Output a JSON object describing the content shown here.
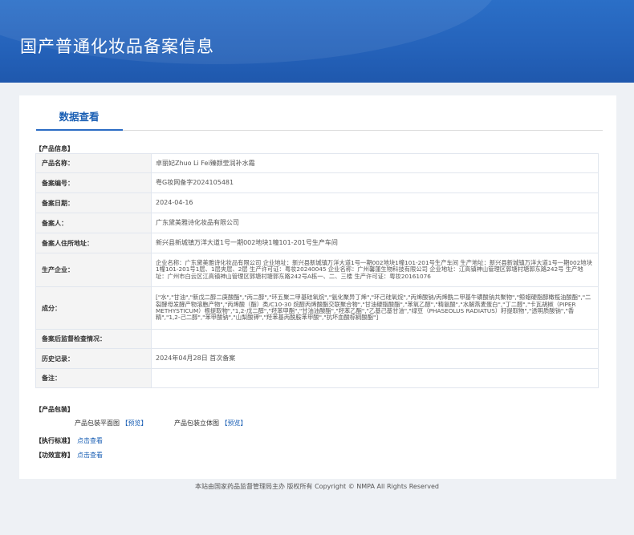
{
  "header": {
    "title": "国产普通化妆品备案信息"
  },
  "tab": {
    "label": "数据查看"
  },
  "product_info": {
    "section_title": "【产品信息】",
    "rows": [
      {
        "label": "产品名称：",
        "value": "卓丽妃Zhuo Li Fei臻颜莹润补水霜"
      },
      {
        "label": "备案编号：",
        "value": "粤G妆网备字2024105481"
      },
      {
        "label": "备案日期：",
        "value": "2024-04-16"
      },
      {
        "label": "备案人：",
        "value": "广东黛美雅诗化妆品有限公司"
      },
      {
        "label": "备案人住所地址：",
        "value": "新兴县新城镇万洋大道1号一期002地块1幢101-201号生产车间"
      },
      {
        "label": "生产企业：",
        "value": "企业名称：广东黛美雅诗化妆品有限公司 企业地址：新兴县新城镇万洋大道1号一期002地块1幢101-201号生产车间 生产地址：新兴县新城镇万洋大道1号一期002地块1幢101-201号1层、1层夹层、2层 生产许可证：粤妆20240045 企业名称：广州馨蓮生物科技有限公司 企业地址：江高镇神山管理区郭塘村塘郭东路242号 生产地址：广州市白云区江高镇神山管理区郭塘村塘郭东路242号A栋一、二、三楼 生产许可证：粤妆20161076"
      },
      {
        "label": "成分：",
        "value": "[\"水\",\"甘油\",\"新戊二醇二庚酸酯\",\"丙二醇\",\"环五聚二甲基硅氧烷\",\"氨化聚异丁烯\",\"环己硅氧烷\",\"丙烯酸钠/丙烯酰二甲基牛磺酸钠共聚物\",\"鲸蜡硬脂醇橄榄油酸酯\",\"二裂酵母发酵产物溶胞产物\",\"丙烯酸（酯）类/C10-30 烷醇丙烯酸酯交联聚合物\",\"甘油硬脂酸酯\",\"苯氧乙醇\",\"精氨酸\",\"水解燕麦蛋白\",\"丁二醇\",\"卡瓦胡椒（PIPER METHYSTICUM）根提取物\",\"1,2-戊二醇\",\"羟苯甲酯\",\"甘油油酸酯\",\"羟苯乙酯\",\"乙基己基甘油\",\"绿豆（PHASEOLUS RADIATUS）籽提取物\",\"透明质酸钠\",\"香精\",\"1,2-己二醇\",\"苯甲酸钠\",\"山梨酸钾\",\"羟苯基丙酰胺苯甲酸\",\"抗坏血酸棕榈酸酯\"]"
      },
      {
        "label": "备案后监督检查情况：",
        "value": ""
      },
      {
        "label": "历史记录：",
        "value": "2024年04月28日 首次备案"
      },
      {
        "label": "备注：",
        "value": ""
      }
    ]
  },
  "packaging": {
    "section_title": "【产品包装】",
    "flat_label": "产品包装平面图",
    "flat_link": "【预览】",
    "solid_label": "产品包装立体图",
    "solid_link": "【预览】"
  },
  "standard": {
    "title": "【执行标准】",
    "link": "点击查看"
  },
  "efficacy": {
    "title": "【功效宣称】",
    "link": "点击查看"
  },
  "footer": {
    "text": "本站由国家药品监督管理局主办 版权所有 Copyright © NMPA All Rights Reserved"
  }
}
